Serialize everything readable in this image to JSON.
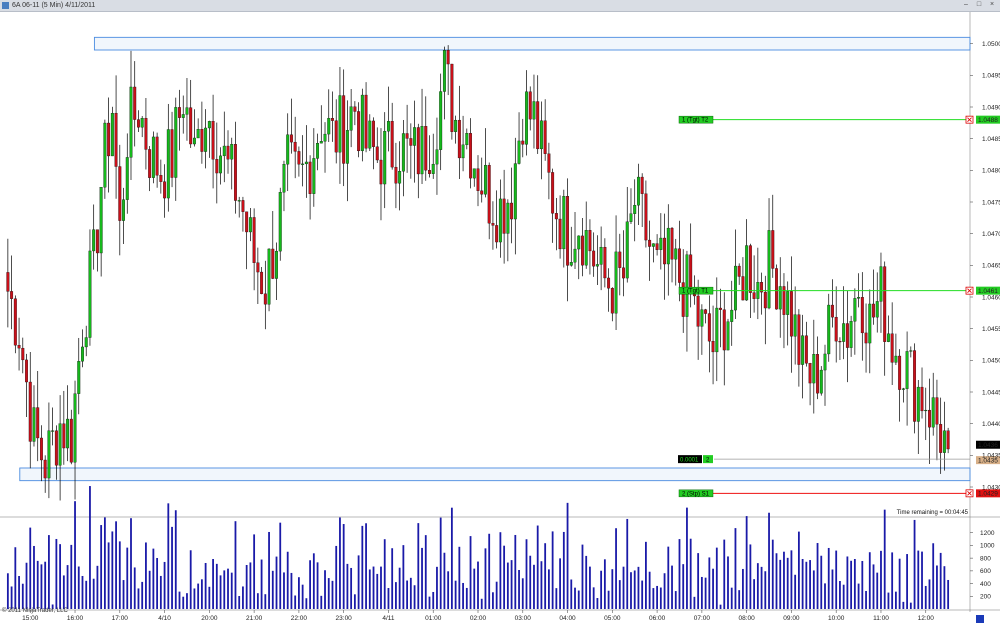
{
  "window": {
    "title": "6A 06-11 (5 Min)  4/11/2011",
    "buttons": [
      "minimize",
      "maximize",
      "close"
    ]
  },
  "status": {
    "time_remaining": "Time remaining = 00:04:45",
    "copyright": "© 2011 NinjaTrader, LLC"
  },
  "colors": {
    "up": "#16b81c",
    "down": "#c8101a",
    "volume": "#1a1aa8",
    "zone": "#4a8ce0",
    "target_line": "#22dd22",
    "stop_line": "#ee1111"
  },
  "orders": [
    {
      "name": "target-2",
      "price": 1.0488,
      "label": "1 (Tgt) T2",
      "price_label": "1.0488"
    },
    {
      "name": "target-1",
      "price": 1.0461,
      "label": "1 (Tgt) T1",
      "price_label": "1.0461"
    },
    {
      "name": "stop",
      "price": 1.0429,
      "label": "2 (Stp) S1",
      "price_label": "1.0429"
    }
  ],
  "position": {
    "pnl": "0.0001",
    "qty": "2",
    "price_label": "1.0435"
  },
  "last_price_label": "1.0436",
  "chart_data": [
    {
      "type": "candlestick",
      "title": "",
      "instrument": "6A 06-11",
      "interval": "5 Min",
      "ylim": [
        1.0427,
        1.0505
      ],
      "y_ticks": [
        "1.0500",
        "1.0495",
        "1.0490",
        "1.0485",
        "1.0480",
        "1.0475",
        "1.0470",
        "1.0465",
        "1.0460",
        "1.0455",
        "1.0450",
        "1.0445",
        "1.0440",
        "1.0435",
        "1.0430"
      ],
      "y_tick_values": [
        1.05,
        1.0495,
        1.049,
        1.0485,
        1.048,
        1.0475,
        1.047,
        1.0465,
        1.046,
        1.0455,
        1.045,
        1.0445,
        1.044,
        1.0435,
        1.043
      ],
      "x_labels": [
        "15:00",
        "16:00",
        "17:00",
        "4/10",
        "20:00",
        "21:00",
        "22:00",
        "23:00",
        "4/11",
        "01:00",
        "02:00",
        "03:00",
        "04:00",
        "05:00",
        "06:00",
        "07:00",
        "08:00",
        "09:00",
        "10:00",
        "11:00",
        "12:00"
      ],
      "x_label_bar_index": [
        6,
        18,
        30,
        42,
        54,
        66,
        78,
        90,
        102,
        114,
        126,
        138,
        150,
        162,
        174,
        186,
        198,
        210,
        222,
        234,
        246
      ],
      "zones": [
        {
          "low": 1.0499,
          "high": 1.0501,
          "from_bar": 24
        },
        {
          "low": 1.0431,
          "high": 1.0433,
          "from_bar": 4
        }
      ],
      "close_series_anchors": [
        [
          0,
          1.0461
        ],
        [
          3,
          1.0455
        ],
        [
          7,
          1.0438
        ],
        [
          10,
          1.0434
        ],
        [
          14,
          1.044
        ],
        [
          17,
          1.0438
        ],
        [
          20,
          1.0456
        ],
        [
          23,
          1.0465
        ],
        [
          25,
          1.0478
        ],
        [
          28,
          1.049
        ],
        [
          30,
          1.047
        ],
        [
          32,
          1.0486
        ],
        [
          35,
          1.049
        ],
        [
          38,
          1.0483
        ],
        [
          41,
          1.048
        ],
        [
          44,
          1.0482
        ],
        [
          47,
          1.0492
        ],
        [
          50,
          1.0482
        ],
        [
          53,
          1.049
        ],
        [
          56,
          1.0485
        ],
        [
          59,
          1.048
        ],
        [
          62,
          1.0476
        ],
        [
          66,
          1.0466
        ],
        [
          69,
          1.0462
        ],
        [
          72,
          1.047
        ],
        [
          75,
          1.048
        ],
        [
          78,
          1.0478
        ],
        [
          81,
          1.0482
        ],
        [
          84,
          1.0488
        ],
        [
          87,
          1.0485
        ],
        [
          90,
          1.0487
        ],
        [
          93,
          1.049
        ],
        [
          96,
          1.0484
        ],
        [
          99,
          1.0482
        ],
        [
          102,
          1.0483
        ],
        [
          105,
          1.0484
        ],
        [
          108,
          1.0482
        ],
        [
          111,
          1.0483
        ],
        [
          114,
          1.0486
        ],
        [
          117,
          1.0495
        ],
        [
          120,
          1.0488
        ],
        [
          123,
          1.0486
        ],
        [
          126,
          1.048
        ],
        [
          129,
          1.0476
        ],
        [
          132,
          1.0474
        ],
        [
          135,
          1.0477
        ],
        [
          138,
          1.049
        ],
        [
          141,
          1.0488
        ],
        [
          144,
          1.048
        ],
        [
          147,
          1.0474
        ],
        [
          150,
          1.047
        ],
        [
          153,
          1.0472
        ],
        [
          156,
          1.0468
        ],
        [
          159,
          1.0463
        ],
        [
          162,
          1.0462
        ],
        [
          165,
          1.0463
        ],
        [
          168,
          1.0475
        ],
        [
          171,
          1.047
        ],
        [
          174,
          1.0464
        ],
        [
          177,
          1.0465
        ],
        [
          180,
          1.0463
        ],
        [
          183,
          1.046
        ],
        [
          186,
          1.0455
        ],
        [
          189,
          1.0452
        ],
        [
          192,
          1.0457
        ],
        [
          195,
          1.0459
        ],
        [
          198,
          1.0466
        ],
        [
          201,
          1.0462
        ],
        [
          204,
          1.0465
        ],
        [
          207,
          1.0463
        ],
        [
          210,
          1.0457
        ],
        [
          213,
          1.0449
        ],
        [
          216,
          1.0447
        ],
        [
          219,
          1.0452
        ],
        [
          222,
          1.0458
        ],
        [
          225,
          1.0455
        ],
        [
          228,
          1.0462
        ],
        [
          231,
          1.0456
        ],
        [
          234,
          1.046
        ],
        [
          237,
          1.0453
        ],
        [
          240,
          1.045
        ],
        [
          243,
          1.0446
        ],
        [
          246,
          1.0444
        ],
        [
          249,
          1.044
        ],
        [
          252,
          1.0436
        ]
      ],
      "bar_count": 253,
      "volume": {
        "ylabel_ticks": [
          "1200",
          "1000",
          "800",
          "600",
          "400",
          "200"
        ],
        "ylabel_tick_values": [
          1200,
          1000,
          800,
          600,
          400,
          200
        ],
        "ylim": [
          0,
          1400
        ]
      }
    }
  ]
}
